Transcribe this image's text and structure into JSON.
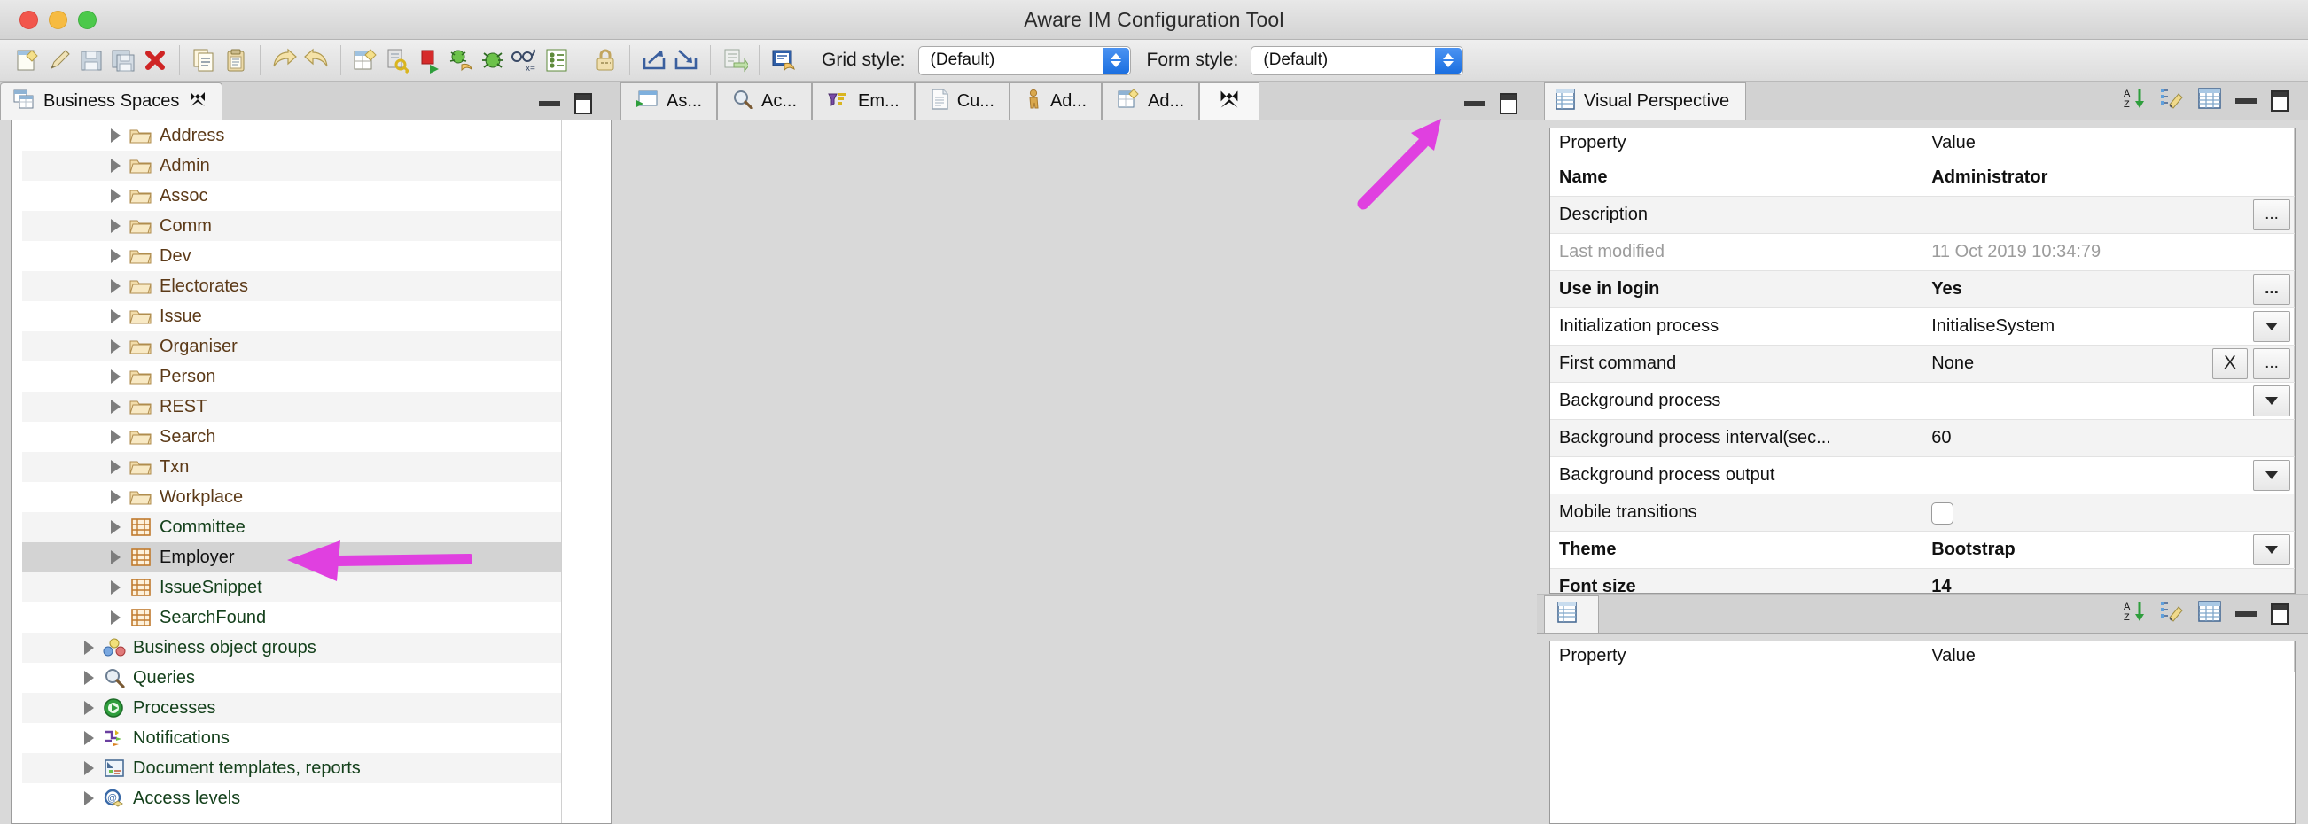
{
  "window": {
    "title": "Aware IM Configuration Tool",
    "traffic_lights": [
      "close",
      "minimize",
      "zoom"
    ]
  },
  "toolbar": {
    "groups": [
      {
        "buttons": [
          {
            "name": "new-icon",
            "tip": "New"
          },
          {
            "name": "edit-pencil-icon",
            "tip": "Edit"
          },
          {
            "name": "save-icon",
            "tip": "Save"
          },
          {
            "name": "save-all-icon",
            "tip": "Save All"
          },
          {
            "name": "delete-red-x-icon",
            "tip": "Delete"
          }
        ]
      },
      {
        "buttons": [
          {
            "name": "copy-icon",
            "tip": "Copy"
          },
          {
            "name": "paste-clipboard-icon",
            "tip": "Paste"
          }
        ]
      },
      {
        "buttons": [
          {
            "name": "undo-arrow-icon",
            "tip": "Undo"
          },
          {
            "name": "redo-arrow-icon",
            "tip": "Redo"
          }
        ]
      },
      {
        "buttons": [
          {
            "name": "new-perspective-icon",
            "tip": "New Visual Perspective"
          },
          {
            "name": "security-key-icon",
            "tip": "Security"
          },
          {
            "name": "stop-run-icon",
            "tip": "Stop / Run"
          },
          {
            "name": "debug-bug-run-icon",
            "tip": "Debug"
          },
          {
            "name": "bug-icon",
            "tip": "Bug"
          },
          {
            "name": "spectacles-rules-icon",
            "tip": "Rules"
          },
          {
            "name": "checklist-icon",
            "tip": "Validate"
          }
        ]
      },
      {
        "buttons": [
          {
            "name": "lock-icon",
            "tip": "Lock"
          }
        ]
      },
      {
        "buttons": [
          {
            "name": "export-icon",
            "tip": "Export"
          },
          {
            "name": "import-icon",
            "tip": "Import"
          }
        ]
      },
      {
        "buttons": [
          {
            "name": "documentation-icon",
            "tip": "Documentation"
          }
        ]
      },
      {
        "buttons": [
          {
            "name": "query-tool-icon",
            "tip": "Query Tool"
          }
        ]
      }
    ],
    "grid_style": {
      "label": "Grid style:",
      "value": "(Default)"
    },
    "form_style": {
      "label": "Form style:",
      "value": "(Default)"
    }
  },
  "left_panel": {
    "tab": {
      "label": "Business Spaces",
      "icon": "business-spaces-icon",
      "close_icon": "close-x-icon"
    },
    "header_icons": [
      "minimize-icon",
      "maximize-icon"
    ],
    "tree": [
      {
        "label": "Address",
        "icon": "folder-icon",
        "kind": "folder",
        "indent": 1,
        "selected": false
      },
      {
        "label": "Admin",
        "icon": "folder-icon",
        "kind": "folder",
        "indent": 1,
        "selected": false
      },
      {
        "label": "Assoc",
        "icon": "folder-icon",
        "kind": "folder",
        "indent": 1,
        "selected": false
      },
      {
        "label": "Comm",
        "icon": "folder-icon",
        "kind": "folder",
        "indent": 1,
        "selected": false
      },
      {
        "label": "Dev",
        "icon": "folder-icon",
        "kind": "folder",
        "indent": 1,
        "selected": false
      },
      {
        "label": "Electorates",
        "icon": "folder-icon",
        "kind": "folder",
        "indent": 1,
        "selected": false
      },
      {
        "label": "Issue",
        "icon": "folder-icon",
        "kind": "folder",
        "indent": 1,
        "selected": false
      },
      {
        "label": "Organiser",
        "icon": "folder-icon",
        "kind": "folder",
        "indent": 1,
        "selected": false
      },
      {
        "label": "Person",
        "icon": "folder-icon",
        "kind": "folder",
        "indent": 1,
        "selected": false
      },
      {
        "label": "REST",
        "icon": "folder-icon",
        "kind": "folder",
        "indent": 1,
        "selected": false
      },
      {
        "label": "Search",
        "icon": "folder-icon",
        "kind": "folder",
        "indent": 1,
        "selected": false
      },
      {
        "label": "Txn",
        "icon": "folder-icon",
        "kind": "folder",
        "indent": 1,
        "selected": false
      },
      {
        "label": "Workplace",
        "icon": "folder-icon",
        "kind": "folder",
        "indent": 1,
        "selected": false
      },
      {
        "label": "Committee",
        "icon": "business-object-icon",
        "kind": "object",
        "indent": 1,
        "selected": false
      },
      {
        "label": "Employer",
        "icon": "business-object-icon",
        "kind": "object",
        "indent": 1,
        "selected": true
      },
      {
        "label": "IssueSnippet",
        "icon": "business-object-icon",
        "kind": "object",
        "indent": 1,
        "selected": false
      },
      {
        "label": "SearchFound",
        "icon": "business-object-icon",
        "kind": "object",
        "indent": 1,
        "selected": false
      },
      {
        "label": "Business object groups",
        "icon": "object-groups-icon",
        "kind": "node",
        "indent": 0,
        "selected": false
      },
      {
        "label": "Queries",
        "icon": "magnifier-icon",
        "kind": "node",
        "indent": 0,
        "selected": false
      },
      {
        "label": "Processes",
        "icon": "process-play-icon",
        "kind": "node",
        "indent": 0,
        "selected": false
      },
      {
        "label": "Notifications",
        "icon": "notifications-icon",
        "kind": "node",
        "indent": 0,
        "selected": false
      },
      {
        "label": "Document templates, reports",
        "icon": "document-template-icon",
        "kind": "node",
        "indent": 0,
        "selected": false
      },
      {
        "label": "Access levels",
        "icon": "access-levels-icon",
        "kind": "node",
        "indent": 0,
        "selected": false
      }
    ]
  },
  "editor": {
    "tabs": [
      {
        "label": "As...",
        "icon": "run-window-icon",
        "active": false
      },
      {
        "label": "Ac...",
        "icon": "magnifier-icon",
        "active": false
      },
      {
        "label": "Em...",
        "icon": "notification-icon",
        "active": false
      },
      {
        "label": "Cu...",
        "icon": "document-icon",
        "active": false
      },
      {
        "label": "Ad...",
        "icon": "person-icon",
        "active": false
      },
      {
        "label": "Ad...",
        "icon": "perspective-icon",
        "active": false
      }
    ],
    "close_tab_icon": "close-x-icon",
    "header_icons": [
      "minimize-icon",
      "maximize-icon"
    ]
  },
  "right_panel": {
    "tab": {
      "label": "Visual Perspective",
      "icon": "perspective-table-icon"
    },
    "header_icons": [
      "sort-az-icon",
      "filter-edit-icon",
      "table-icon",
      "minimize-icon",
      "maximize-icon"
    ],
    "table": {
      "columns": [
        "Property",
        "Value"
      ],
      "rows": [
        {
          "property": "Name",
          "bold": true,
          "value": "Administrator",
          "control": "none",
          "dim": false
        },
        {
          "property": "Description",
          "bold": false,
          "value": "",
          "control": "ellipsis",
          "dim": false
        },
        {
          "property": "Last modified",
          "bold": false,
          "value": "11 Oct 2019 10:34:79",
          "control": "none",
          "dim": true
        },
        {
          "property": "Use in login",
          "bold": true,
          "value": "Yes",
          "control": "ellipsis",
          "dim": false
        },
        {
          "property": "Initialization process",
          "bold": false,
          "value": "InitialiseSystem",
          "control": "dropdown",
          "dim": false
        },
        {
          "property": "First command",
          "bold": false,
          "value": "None",
          "control": "x-ellipsis",
          "dim": false
        },
        {
          "property": "Background process",
          "bold": false,
          "value": "",
          "control": "dropdown",
          "dim": false
        },
        {
          "property": "Background process interval(sec...",
          "bold": false,
          "value": "60",
          "control": "none",
          "dim": false
        },
        {
          "property": "Background process output",
          "bold": false,
          "value": "",
          "control": "dropdown",
          "dim": false
        },
        {
          "property": "Mobile transitions",
          "bold": false,
          "value": "",
          "control": "checkbox",
          "dim": false
        },
        {
          "property": "Theme",
          "bold": true,
          "value": "Bootstrap",
          "control": "dropdown",
          "dim": false
        },
        {
          "property": "Font size",
          "bold": true,
          "value": "14",
          "control": "none",
          "dim": false
        }
      ],
      "x_button_label": "X",
      "ellipsis_label": "..."
    }
  },
  "bottom_right_panel": {
    "tab": {
      "label": "",
      "icon": "properties-table-icon"
    },
    "header_icons": [
      "sort-az-icon",
      "filter-edit-icon",
      "table-icon",
      "minimize-icon",
      "maximize-icon"
    ],
    "table": {
      "columns": [
        "Property",
        "Value"
      ],
      "rows": []
    }
  },
  "annotations": {
    "color": "#e040e0",
    "arrows": [
      {
        "name": "arrow-pointing-to-close-tab",
        "target": "editor close tab button"
      },
      {
        "name": "arrow-pointing-to-employer-row",
        "target": "Employer tree row"
      }
    ]
  }
}
